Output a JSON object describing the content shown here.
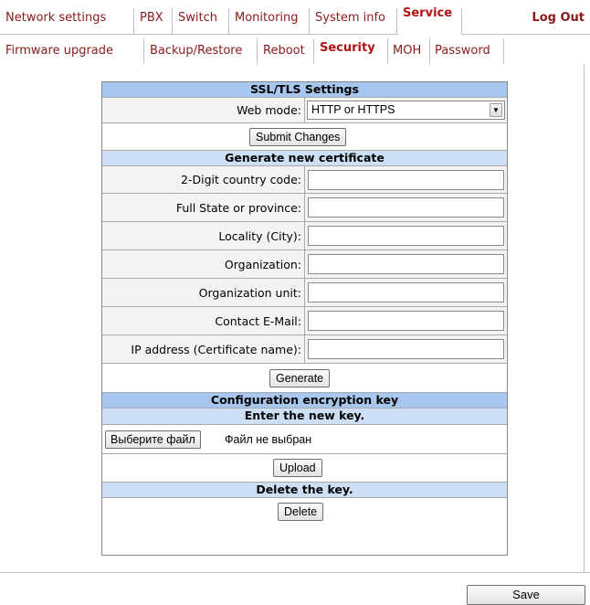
{
  "top_nav": {
    "tabs": [
      "Network settings",
      "PBX",
      "Switch",
      "Monitoring",
      "System info",
      "Service"
    ],
    "active": "Service",
    "logout_label": "Log Out"
  },
  "sub_nav": {
    "tabs": [
      "Firmware upgrade",
      "Backup/Restore",
      "Reboot",
      "Security",
      "MOH",
      "Password"
    ],
    "active": "Security"
  },
  "ssl": {
    "header": "SSL/TLS Settings",
    "web_mode_label": "Web mode:",
    "web_mode_value": "HTTP or HTTPS",
    "submit_label": "Submit Changes"
  },
  "certificate": {
    "header": "Generate new certificate",
    "fields": [
      {
        "label": "2-Digit country code:",
        "value": ""
      },
      {
        "label": "Full State or province:",
        "value": ""
      },
      {
        "label": "Locality (City):",
        "value": ""
      },
      {
        "label": "Organization:",
        "value": ""
      },
      {
        "label": "Organization unit:",
        "value": ""
      },
      {
        "label": "Contact E-Mail:",
        "value": ""
      },
      {
        "label": "IP address (Certificate name):",
        "value": ""
      }
    ],
    "generate_label": "Generate"
  },
  "encryption": {
    "header": "Configuration encryption key",
    "enter_header": "Enter the new key.",
    "choose_file_label": "Выберите файл",
    "no_file_label": "Файл не выбран",
    "upload_label": "Upload",
    "delete_header": "Delete the key.",
    "delete_label": "Delete"
  },
  "footer": {
    "save_label": "Save"
  },
  "colors": {
    "link": "#8b1a1a",
    "header_bg": "#cddff5",
    "header_strong_bg": "#a8c7ee"
  }
}
